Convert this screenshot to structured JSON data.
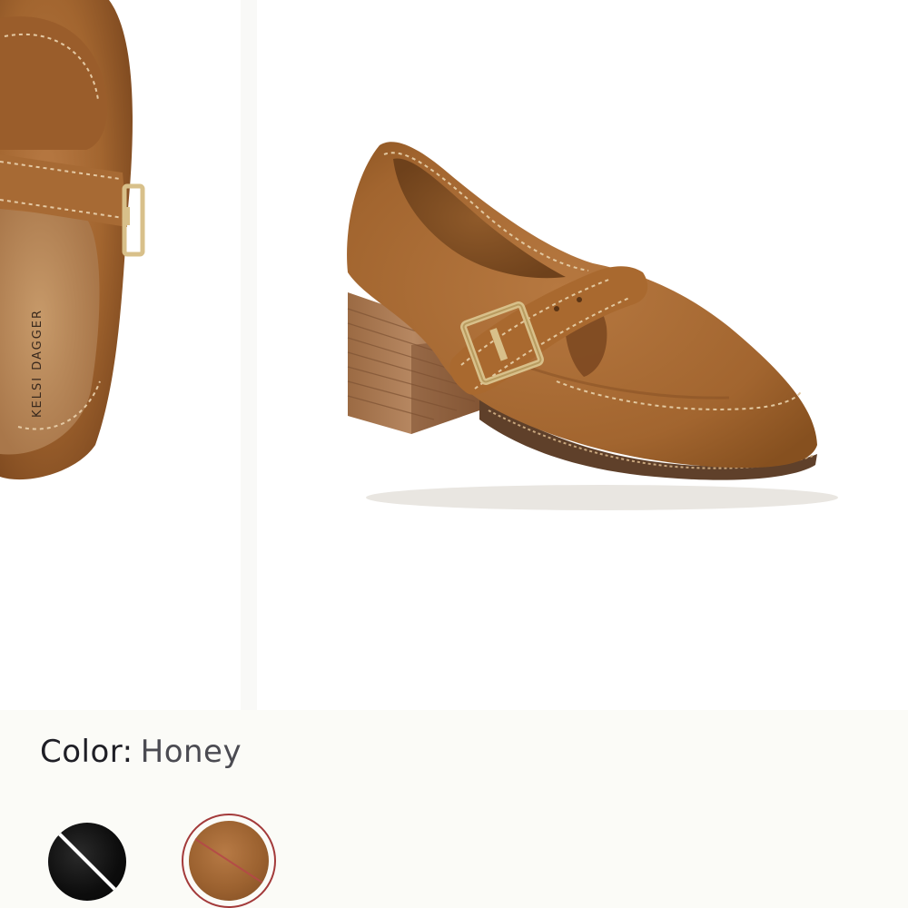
{
  "product": {
    "brand_on_insole": "KELSI DAGGER",
    "image_alt": "Honey suede heeled loafer with buckle strap"
  },
  "color_selector": {
    "label": "Color:",
    "selected_value": "Honey",
    "swatches": [
      {
        "name": "Black",
        "hex": "#0d0d0d",
        "available": false,
        "selected": false
      },
      {
        "name": "Honey",
        "hex": "#9c6230",
        "available": false,
        "selected": true
      }
    ]
  },
  "colors": {
    "suede": "#a2652f",
    "suede_dark": "#7f4a20",
    "sole": "#6b4a30",
    "heel_wood": "#a7774f",
    "buckle_gold": "#d8c08a",
    "unavailable_stroke": "#a33a3a"
  }
}
